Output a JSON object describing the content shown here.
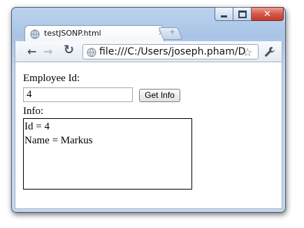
{
  "window": {
    "controls": {
      "minimize": "minimize-icon",
      "maximize": "maximize-icon",
      "close": "close-icon"
    }
  },
  "tab": {
    "title": "testJSONP.html",
    "close": "×",
    "new_tab": "+"
  },
  "toolbar": {
    "url": "file:///C:/Users/joseph.pham/D"
  },
  "page": {
    "employee_id_label": "Employee Id:",
    "employee_id_value": "4",
    "get_info_button": "Get Info",
    "info_label": "Info:",
    "info_lines": [
      "Id = 4",
      "Name = Markus"
    ]
  },
  "colors": {
    "frame": "#b4cce9",
    "close_button": "#d5574a",
    "content_background": "#ffffff"
  }
}
